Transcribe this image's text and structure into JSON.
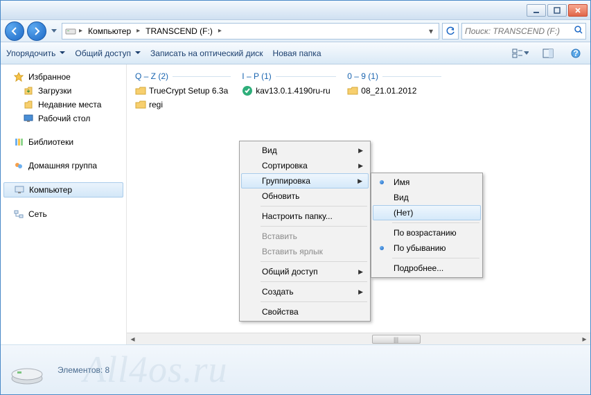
{
  "titlebar": {},
  "breadcrumb": {
    "root": "Компьютер",
    "drive": "TRANSCEND (F:)"
  },
  "search": {
    "placeholder": "Поиск: TRANSCEND (F:)"
  },
  "toolbar": {
    "organize": "Упорядочить",
    "share": "Общий доступ",
    "burn": "Записать на оптический диск",
    "new_folder": "Новая папка"
  },
  "sidebar": {
    "favorites": "Избранное",
    "downloads": "Загрузки",
    "recent": "Недавние места",
    "desktop": "Рабочий стол",
    "libraries": "Библиотеки",
    "homegroup": "Домашняя группа",
    "computer": "Компьютер",
    "network": "Сеть"
  },
  "groups": {
    "g1": {
      "header": "Q – Z (2)",
      "items": [
        "TrueCrypt Setup 6.3a",
        "regi"
      ]
    },
    "g2": {
      "header": "I – P (1)",
      "items": [
        "kav13.0.1.4190ru-ru"
      ]
    },
    "g3": {
      "header": "0 – 9 (1)",
      "items": [
        "08_21.01.2012"
      ]
    }
  },
  "context_main": {
    "view": "Вид",
    "sort": "Сортировка",
    "group": "Группировка",
    "refresh": "Обновить",
    "customize": "Настроить папку...",
    "paste": "Вставить",
    "paste_shortcut": "Вставить ярлык",
    "share": "Общий доступ",
    "new": "Создать",
    "properties": "Свойства"
  },
  "context_sub": {
    "name": "Имя",
    "type": "Вид",
    "none": "(Нет)",
    "asc": "По возрастанию",
    "desc": "По убыванию",
    "more": "Подробнее..."
  },
  "details": {
    "count_label": "Элементов: 8"
  },
  "watermark": "All4os.ru"
}
